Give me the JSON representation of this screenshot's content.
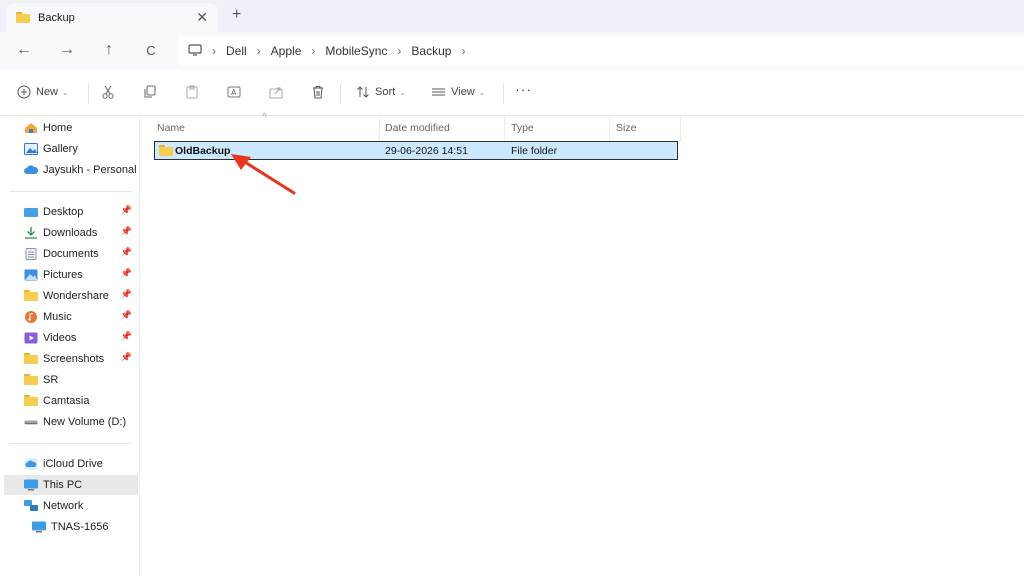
{
  "window": {
    "tab_title": "Backup",
    "tab_close": "✕",
    "tab_add": "+"
  },
  "nav": {
    "back": "←",
    "forward": "→",
    "up": "↑",
    "refresh": "C",
    "breadcrumb": [
      "Dell",
      "Apple",
      "MobileSync",
      "Backup"
    ],
    "separator": "›"
  },
  "toolbar": {
    "new_label": "New",
    "sort_label": "Sort",
    "view_label": "View",
    "more_label": "···"
  },
  "sidebar": {
    "quick": [
      {
        "label": "Home",
        "icon": "home-icon"
      },
      {
        "label": "Gallery",
        "icon": "gallery-icon"
      },
      {
        "label": "Jaysukh - Personal",
        "icon": "cloud-icon"
      }
    ],
    "pinned": [
      {
        "label": "Desktop",
        "icon": "desktop-icon"
      },
      {
        "label": "Downloads",
        "icon": "download-icon"
      },
      {
        "label": "Documents",
        "icon": "document-icon"
      },
      {
        "label": "Pictures",
        "icon": "pictures-icon"
      },
      {
        "label": "Wondershare",
        "icon": "folder-icon"
      },
      {
        "label": "Music",
        "icon": "music-icon"
      },
      {
        "label": "Videos",
        "icon": "videos-icon"
      },
      {
        "label": "Screenshots",
        "icon": "folder-icon"
      },
      {
        "label": "SR",
        "icon": "folder-icon"
      },
      {
        "label": "Camtasia",
        "icon": "folder-icon"
      },
      {
        "label": "New Volume (D:)",
        "icon": "drive-icon"
      }
    ],
    "locations": [
      {
        "label": "iCloud Drive",
        "icon": "icloud-icon"
      },
      {
        "label": "This PC",
        "icon": "pc-icon",
        "selected": true
      },
      {
        "label": "Network",
        "icon": "network-icon"
      },
      {
        "label": "TNAS-1656",
        "icon": "monitor-icon"
      }
    ]
  },
  "columns": {
    "name": "Name",
    "date": "Date modified",
    "type": "Type",
    "size": "Size"
  },
  "files": [
    {
      "name": "OldBackup",
      "date": "29-06-2026 14:51",
      "type": "File folder",
      "size": ""
    }
  ],
  "colors": {
    "selection": "#cce8ff",
    "folder": "#f7cd4f",
    "arrow": "#e8341c"
  }
}
